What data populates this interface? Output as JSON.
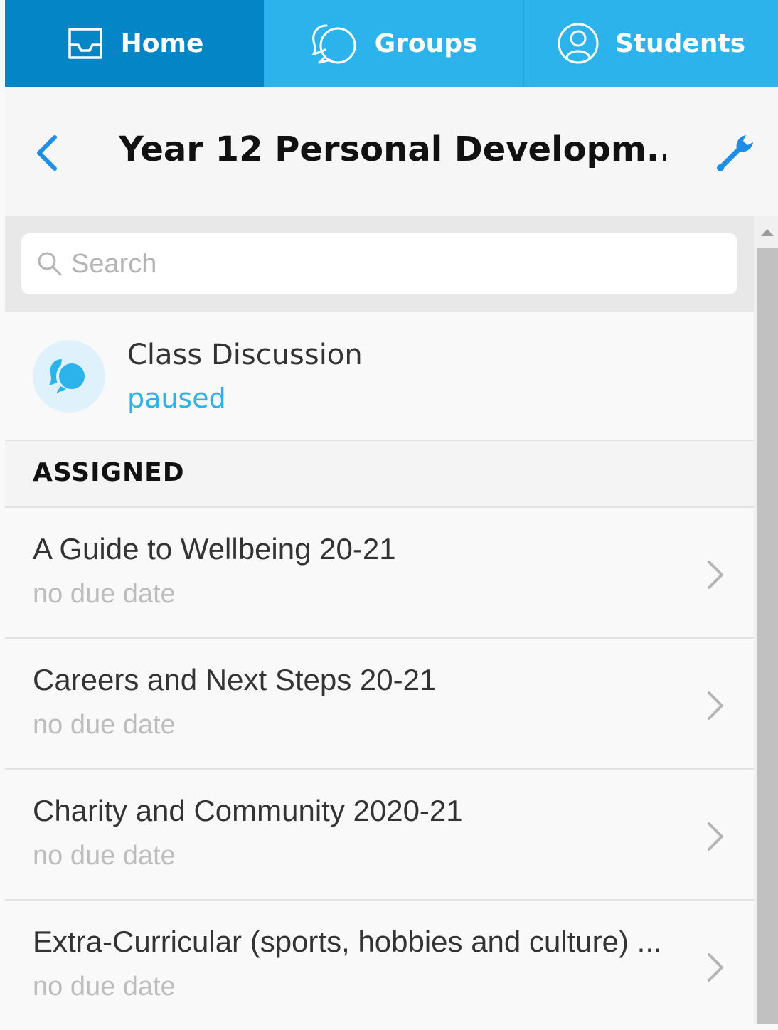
{
  "tabs": [
    {
      "label": "Home",
      "icon": "inbox-icon",
      "active": true
    },
    {
      "label": "Groups",
      "icon": "chat-bubbles-icon",
      "active": false
    },
    {
      "label": "Students",
      "icon": "user-circle-icon",
      "active": false
    }
  ],
  "header": {
    "title": "Year 12 Personal Developm..."
  },
  "search": {
    "placeholder": "Search",
    "value": ""
  },
  "discussion": {
    "title": "Class Discussion",
    "status": "paused"
  },
  "section": {
    "label": "ASSIGNED"
  },
  "items": [
    {
      "name": "A Guide to Wellbeing 20-21",
      "due": "no due date"
    },
    {
      "name": "Careers and Next Steps 20-21",
      "due": "no due date"
    },
    {
      "name": "Charity and Community 2020-21",
      "due": "no due date"
    },
    {
      "name": "Extra-Curricular (sports, hobbies and culture) ...",
      "due": "no due date"
    }
  ],
  "colors": {
    "accent": "#2db3ec",
    "active_tab": "#0485c6",
    "tab_bar": "#2db3ec"
  }
}
